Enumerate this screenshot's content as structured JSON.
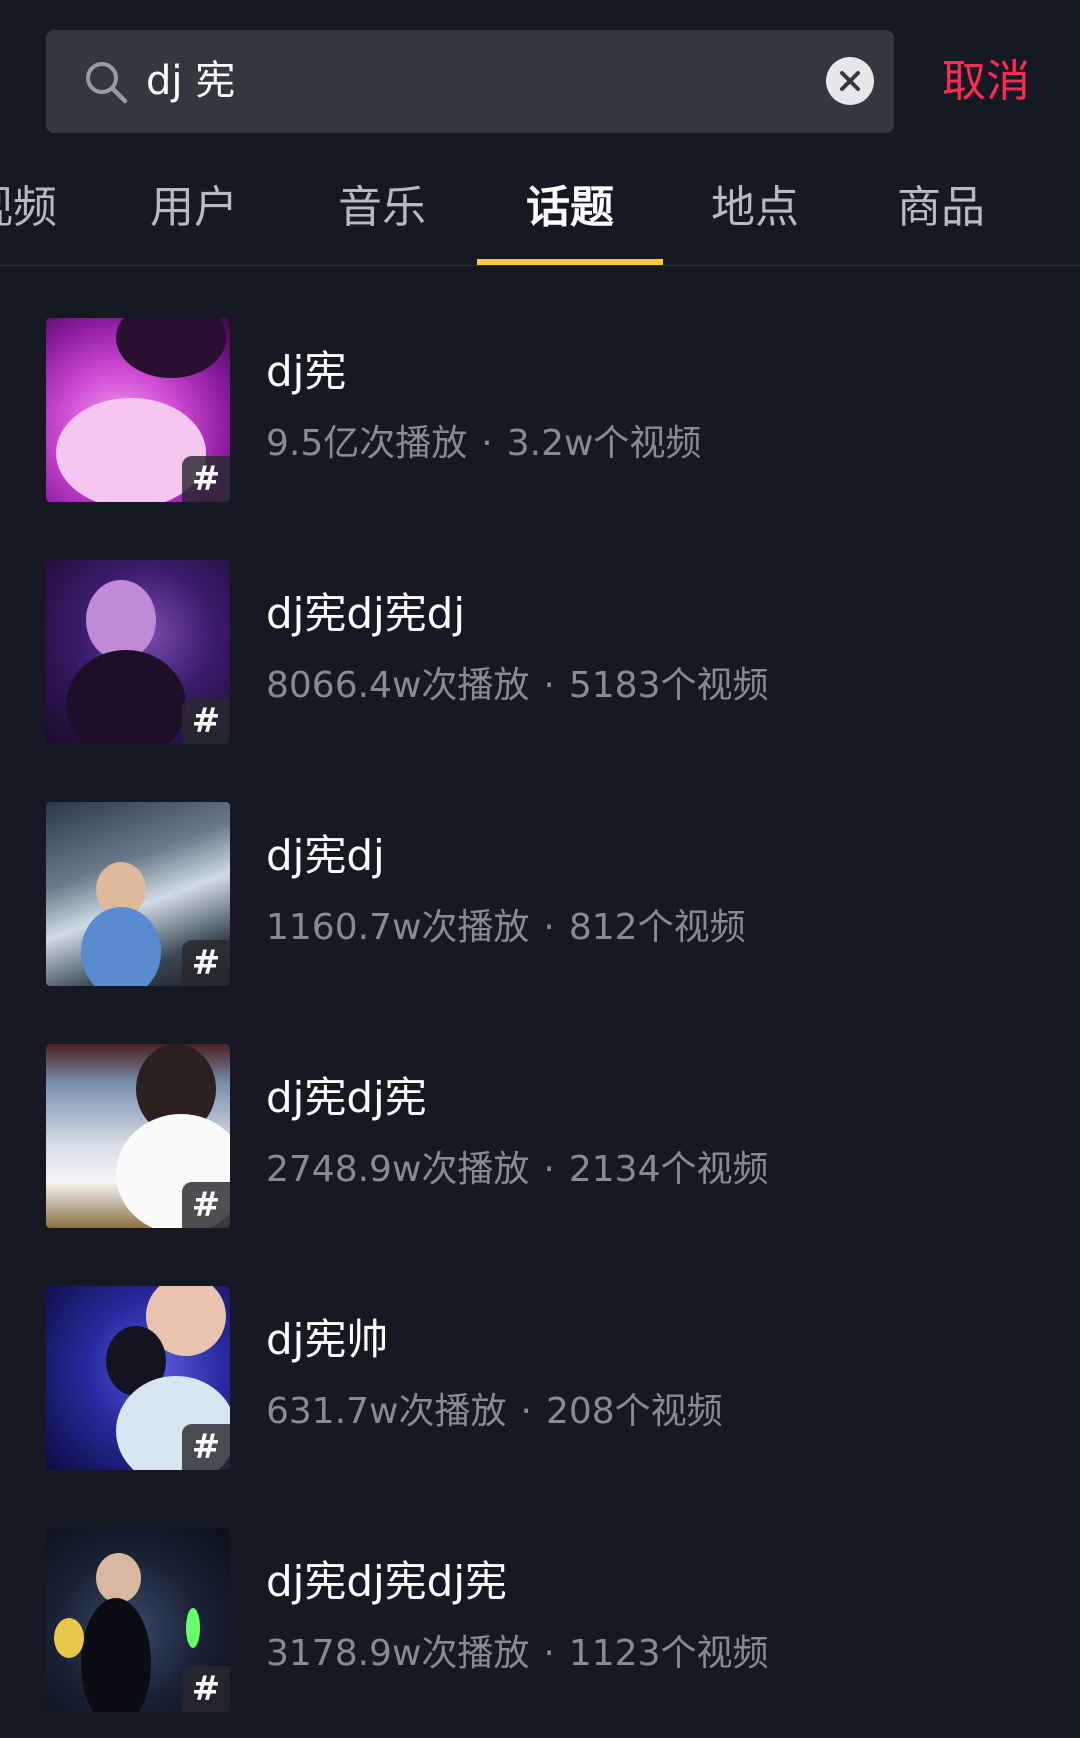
{
  "search": {
    "query": "dj 宪",
    "cancel_label": "取消"
  },
  "tabs": [
    {
      "label": "视频",
      "active": false
    },
    {
      "label": "用户",
      "active": false
    },
    {
      "label": "音乐",
      "active": false
    },
    {
      "label": "话题",
      "active": true
    },
    {
      "label": "地点",
      "active": false
    },
    {
      "label": "商品",
      "active": false
    }
  ],
  "results": [
    {
      "title": "dj宪",
      "plays": "9.5亿次播放",
      "separator": "·",
      "videos": "3.2w个视频",
      "badge": "#"
    },
    {
      "title": "dj宪dj宪dj",
      "plays": "8066.4w次播放",
      "separator": "·",
      "videos": "5183个视频",
      "badge": "#"
    },
    {
      "title": "dj宪dj",
      "plays": "1160.7w次播放",
      "separator": "·",
      "videos": "812个视频",
      "badge": "#"
    },
    {
      "title": "dj宪dj宪",
      "plays": "2748.9w次播放",
      "separator": "·",
      "videos": "2134个视频",
      "badge": "#"
    },
    {
      "title": "dj宪帅",
      "plays": "631.7w次播放",
      "separator": "·",
      "videos": "208个视频",
      "badge": "#"
    },
    {
      "title": "dj宪dj宪dj宪",
      "plays": "3178.9w次播放",
      "separator": "·",
      "videos": "1123个视频",
      "badge": "#"
    }
  ],
  "colors": {
    "background": "#161823",
    "accent_cancel": "#fe2c55",
    "tab_indicator": "#facc2a",
    "search_field": "#343640"
  },
  "icons": {
    "search": "search-icon",
    "clear": "clear-icon",
    "topic": "hashtag-icon"
  }
}
